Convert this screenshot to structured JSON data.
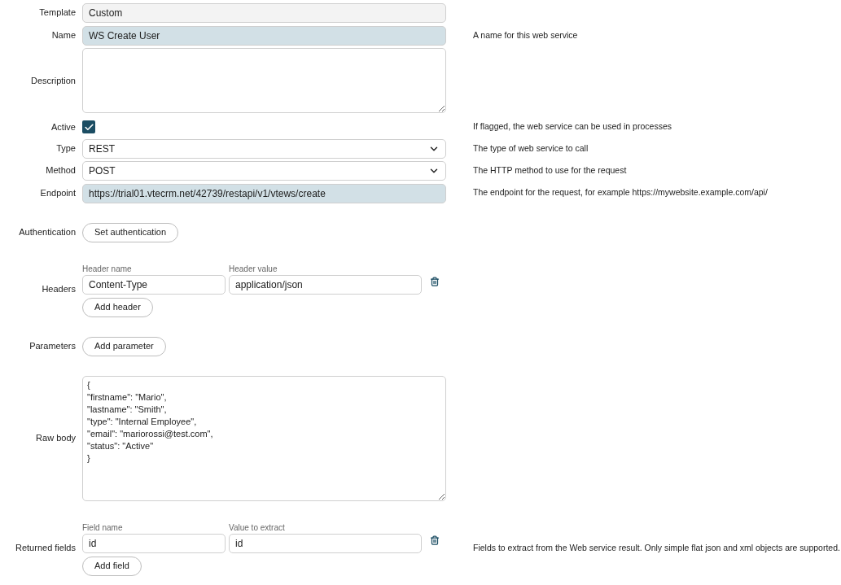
{
  "fields": [
    {
      "kind": "text",
      "label": "Template",
      "value": "Custom",
      "readonly": true
    },
    {
      "kind": "text",
      "label": "Name",
      "value": "WS Create User",
      "highlighted": true,
      "help": "A name for this web service"
    },
    {
      "kind": "textarea",
      "label": "Description"
    },
    {
      "kind": "checkbox",
      "label": "Active",
      "checked": true,
      "help": "If flagged, the web service can be used in processes"
    },
    {
      "kind": "select",
      "label": "Type",
      "value": "REST",
      "help": "The type of web service to call"
    },
    {
      "kind": "select",
      "label": "Method",
      "value": "POST",
      "help": "The HTTP method to use for the request"
    },
    {
      "kind": "text",
      "label": "Endpoint",
      "value": "https://trial01.vtecrm.net/42739/restapi/v1/vtews/create",
      "highlighted": true,
      "help": "The endpoint for the request, for example https://mywebsite.example.com/api/"
    },
    {
      "kind": "button",
      "label": "Authentication",
      "button": "Set authentication"
    },
    {
      "kind": "pairs",
      "label": "Headers",
      "columns": [
        "Header name",
        "Header value"
      ],
      "rows": [
        [
          "Content-Type",
          "application/json"
        ]
      ],
      "button": "Add header"
    },
    {
      "kind": "button",
      "label": "Parameters",
      "button": "Add parameter"
    },
    {
      "kind": "code",
      "label": "Raw body",
      "lines": [
        "{",
        "\"firstname\": \"Mario\",",
        "\"lastname\": \"Smith\",",
        "\"type\": \"Internal Employee\",",
        "\"email\": \"mariorossi@test.com\",",
        "\"status\": \"Active\"",
        "}"
      ]
    },
    {
      "kind": "pairs",
      "label": "Returned fields",
      "columns": [
        "Field name",
        "Value to extract"
      ],
      "rows": [
        [
          "id",
          "id"
        ]
      ],
      "button": "Add field",
      "help": "Fields to extract from the Web service result. Only simple flat json and xml objects are supported."
    }
  ]
}
